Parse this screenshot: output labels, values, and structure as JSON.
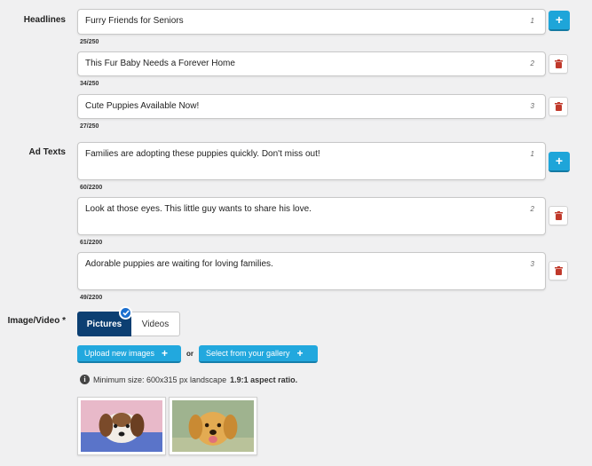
{
  "headlines": {
    "label": "Headlines",
    "items": [
      {
        "text": "Furry Friends for Seniors",
        "index": "1",
        "count": "25/250",
        "action": "add"
      },
      {
        "text": "This Fur Baby Needs a Forever Home",
        "index": "2",
        "count": "34/250",
        "action": "delete"
      },
      {
        "text": "Cute Puppies Available Now!",
        "index": "3",
        "count": "27/250",
        "action": "delete"
      }
    ]
  },
  "ad_texts": {
    "label": "Ad Texts",
    "items": [
      {
        "text": "Families are adopting these puppies quickly. Don't miss out!",
        "index": "1",
        "count": "60/2200",
        "action": "add"
      },
      {
        "text": "Look at those eyes. This little guy wants to share his love.",
        "index": "2",
        "count": "61/2200",
        "action": "delete"
      },
      {
        "text": "Adorable puppies are waiting for loving families.",
        "index": "3",
        "count": "49/2200",
        "action": "delete"
      }
    ]
  },
  "media": {
    "label": "Image/Video",
    "required_mark": "*",
    "tabs": [
      {
        "label": "Pictures",
        "selected": true
      },
      {
        "label": "Videos",
        "selected": false
      }
    ],
    "upload_button": "Upload new images",
    "or_text": "or",
    "gallery_button": "Select from your gallery",
    "info_text": "Minimum size: 600x315 px landscape",
    "info_bold": "1.9:1 aspect ratio."
  },
  "buttons": {
    "add_symbol": "+"
  },
  "icons": {
    "add": "plus-icon",
    "delete": "trash-icon",
    "selected": "check-icon",
    "info": "info-icon"
  },
  "colors": {
    "accent": "#1ea5d9",
    "selected_tab": "#0c3f72",
    "delete": "#c0392b"
  }
}
